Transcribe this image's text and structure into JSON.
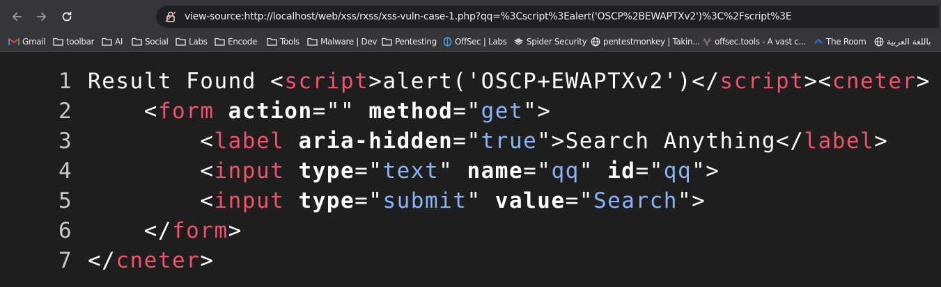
{
  "browser": {
    "url": "view-source:http://localhost/web/xss/rxss/xss-vuln-case-1.php?qq=%3Cscript%3Ealert('OSCP%2BEWAPTXv2')%3C%2Fscript%3E",
    "back_icon": "back-arrow-icon",
    "forward_icon": "forward-arrow-icon",
    "reload_icon": "reload-icon",
    "security_icon": "not-secure-icon"
  },
  "bookmarks": [
    {
      "label": "Gmail",
      "icon": "gmail-icon"
    },
    {
      "label": "toolbar",
      "icon": "folder-icon"
    },
    {
      "label": "AI",
      "icon": "folder-icon"
    },
    {
      "label": "Social",
      "icon": "folder-icon"
    },
    {
      "label": "Labs",
      "icon": "folder-icon"
    },
    {
      "label": "Encode",
      "icon": "folder-icon"
    },
    {
      "label": "Tools",
      "icon": "folder-icon"
    },
    {
      "label": "Malware | Dev",
      "icon": "folder-icon"
    },
    {
      "label": "Pentesting",
      "icon": "folder-icon"
    },
    {
      "label": "OffSec | Labs",
      "icon": "offsec-icon"
    },
    {
      "label": "Spider Security",
      "icon": "spider-icon"
    },
    {
      "label": "pentestmonkey | Takin...",
      "icon": "globe-icon"
    },
    {
      "label": "offsec.tools - A vast c...",
      "icon": "offsec-tools-icon"
    },
    {
      "label": "The Room",
      "icon": "room-icon"
    },
    {
      "label": "باللغة العربية",
      "icon": "globe-icon"
    }
  ],
  "source_lines": [
    {
      "number": "1",
      "tokens": [
        {
          "t": "Result Found ",
          "c": "punc"
        },
        {
          "t": "<",
          "c": "punc"
        },
        {
          "t": "script",
          "c": "tag"
        },
        {
          "t": ">",
          "c": "punc"
        },
        {
          "t": "alert('OSCP+EWAPTXv2')",
          "c": "punc"
        },
        {
          "t": "</",
          "c": "punc"
        },
        {
          "t": "script",
          "c": "tag"
        },
        {
          "t": ">",
          "c": "punc"
        },
        {
          "t": "<",
          "c": "punc"
        },
        {
          "t": "cneter",
          "c": "tag"
        },
        {
          "t": ">",
          "c": "punc"
        }
      ]
    },
    {
      "number": "2",
      "tokens": [
        {
          "t": "    <",
          "c": "punc"
        },
        {
          "t": "form",
          "c": "tag"
        },
        {
          "t": " ",
          "c": "punc"
        },
        {
          "t": "action",
          "c": "attr"
        },
        {
          "t": "=\"\"",
          "c": "punc"
        },
        {
          "t": " ",
          "c": "punc"
        },
        {
          "t": "method",
          "c": "attr"
        },
        {
          "t": "=\"",
          "c": "punc"
        },
        {
          "t": "get",
          "c": "val"
        },
        {
          "t": "\">",
          "c": "punc"
        }
      ]
    },
    {
      "number": "3",
      "tokens": [
        {
          "t": "        <",
          "c": "punc"
        },
        {
          "t": "label",
          "c": "tag"
        },
        {
          "t": " ",
          "c": "punc"
        },
        {
          "t": "aria-hidden",
          "c": "attr"
        },
        {
          "t": "=\"",
          "c": "punc"
        },
        {
          "t": "true",
          "c": "val"
        },
        {
          "t": "\">",
          "c": "punc"
        },
        {
          "t": "Search Anything",
          "c": "punc"
        },
        {
          "t": "</",
          "c": "punc"
        },
        {
          "t": "label",
          "c": "tag"
        },
        {
          "t": ">",
          "c": "punc"
        }
      ]
    },
    {
      "number": "4",
      "tokens": [
        {
          "t": "        <",
          "c": "punc"
        },
        {
          "t": "input",
          "c": "tag"
        },
        {
          "t": " ",
          "c": "punc"
        },
        {
          "t": "type",
          "c": "attr"
        },
        {
          "t": "=\"",
          "c": "punc"
        },
        {
          "t": "text",
          "c": "val"
        },
        {
          "t": "\"",
          "c": "punc"
        },
        {
          "t": " ",
          "c": "punc"
        },
        {
          "t": "name",
          "c": "attr"
        },
        {
          "t": "=\"",
          "c": "punc"
        },
        {
          "t": "qq",
          "c": "val"
        },
        {
          "t": "\"",
          "c": "punc"
        },
        {
          "t": " ",
          "c": "punc"
        },
        {
          "t": "id",
          "c": "attr"
        },
        {
          "t": "=\"",
          "c": "punc"
        },
        {
          "t": "qq",
          "c": "val"
        },
        {
          "t": "\">",
          "c": "punc"
        }
      ]
    },
    {
      "number": "5",
      "tokens": [
        {
          "t": "        <",
          "c": "punc"
        },
        {
          "t": "input",
          "c": "tag"
        },
        {
          "t": " ",
          "c": "punc"
        },
        {
          "t": "type",
          "c": "attr"
        },
        {
          "t": "=\"",
          "c": "punc"
        },
        {
          "t": "submit",
          "c": "val"
        },
        {
          "t": "\"",
          "c": "punc"
        },
        {
          "t": " ",
          "c": "punc"
        },
        {
          "t": "value",
          "c": "attr"
        },
        {
          "t": "=\"",
          "c": "punc"
        },
        {
          "t": "Search",
          "c": "val"
        },
        {
          "t": "\">",
          "c": "punc"
        }
      ]
    },
    {
      "number": "6",
      "tokens": [
        {
          "t": "    </",
          "c": "punc"
        },
        {
          "t": "form",
          "c": "tag"
        },
        {
          "t": ">",
          "c": "punc"
        }
      ]
    },
    {
      "number": "7",
      "tokens": [
        {
          "t": "</",
          "c": "punc"
        },
        {
          "t": "cneter",
          "c": "tag"
        },
        {
          "t": ">",
          "c": "punc"
        }
      ]
    }
  ],
  "colors": {
    "tag": "#f0526a",
    "attribute": "#ffffff",
    "value": "#8ab4f8",
    "text": "#ffffff",
    "background": "#1e1e1f"
  }
}
